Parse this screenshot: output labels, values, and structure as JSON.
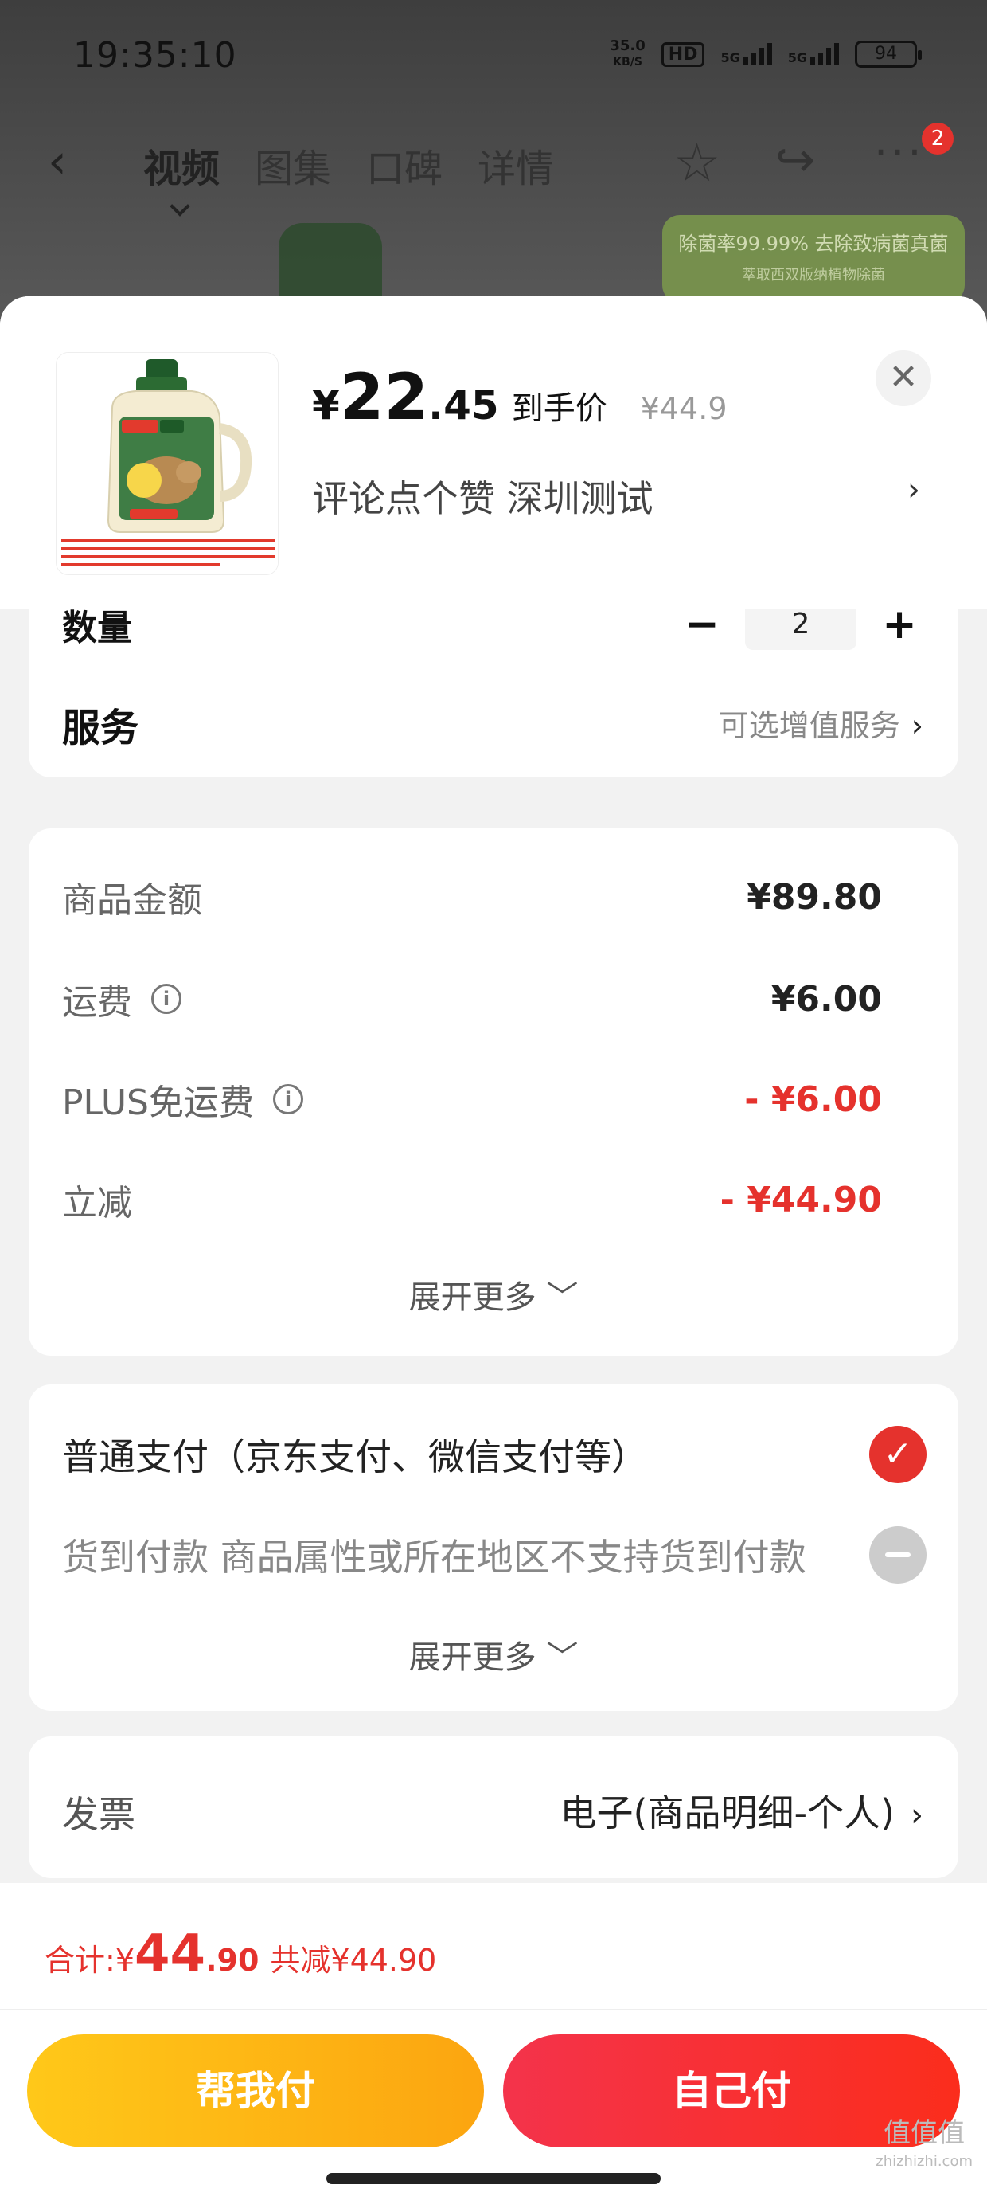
{
  "status_bar": {
    "time": "19:35:10",
    "net_speed_value": "35.0",
    "net_speed_unit": "KB/S",
    "hd": "HD",
    "signal_1": "5G",
    "signal_2": "5G",
    "battery": "94"
  },
  "nav": {
    "tabs": [
      "视频",
      "图集",
      "口碑",
      "详情"
    ],
    "active_tab": "视频",
    "badge": "2"
  },
  "promo": {
    "text": "除菌率99.99% 去除致病菌真菌",
    "sub": "萃取西双版纳植物除菌"
  },
  "product": {
    "price_yen": "¥",
    "price_int": "22",
    "price_dec": ".45",
    "price_label": "到手价",
    "original_price": "¥44.9",
    "shop_line": "评论点个赞  深圳测试"
  },
  "quantity": {
    "label": "数量",
    "value": "2"
  },
  "service": {
    "label": "服务",
    "value": "可选增值服务"
  },
  "cost": {
    "rows": [
      {
        "key": "商品金额",
        "value": "¥89.80"
      },
      {
        "key": "运费",
        "value": "¥6.00"
      },
      {
        "key": "PLUS免运费",
        "value": "- ¥6.00"
      },
      {
        "key": "立减",
        "value": "- ¥44.90"
      }
    ],
    "expand": "展开更多 ﹀"
  },
  "payment": {
    "normal": "普通支付（京东支付、微信支付等）",
    "cod": "货到付款 商品属性或所在地区不支持货到付款",
    "expand": "展开更多 ﹀"
  },
  "invoice": {
    "label": "发票",
    "value": "电子(商品明细-个人)"
  },
  "footer": {
    "total_label": "合计:",
    "total_yen": "¥",
    "total_int": "44",
    "total_dec": ".90",
    "saved": "共减¥44.90",
    "btn_help": "帮我付",
    "btn_self": "自己付"
  },
  "watermark": {
    "text": "值值值",
    "url": "zhizhizhi.com"
  },
  "colors": {
    "accent_red": "#e5322d",
    "yellow_btn": "#fdb515",
    "red_btn": "#f63037"
  }
}
